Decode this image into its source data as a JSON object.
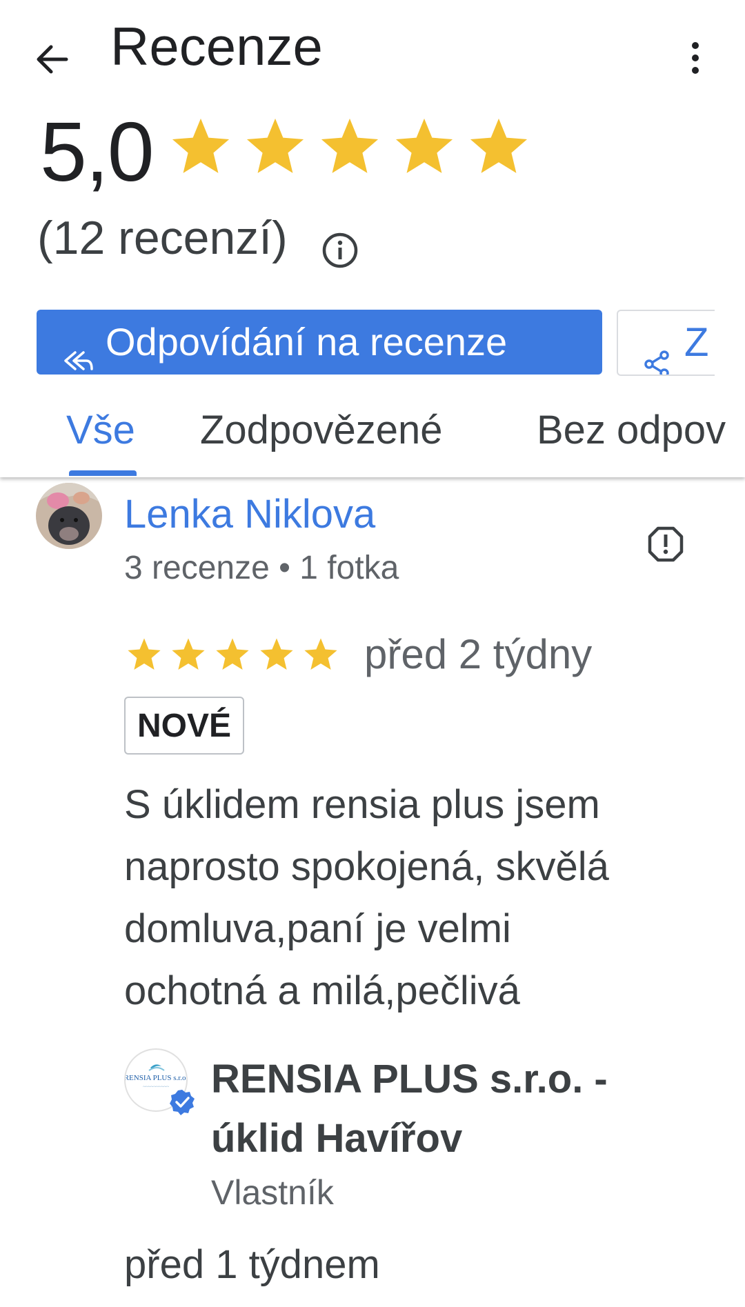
{
  "header": {
    "title": "Recenze",
    "rating": "5,0",
    "stars": 5,
    "review_count": "(12 recenzí)"
  },
  "actions": {
    "reply_label": "Odpovídání na recenze",
    "share_label_partial": "Z"
  },
  "tabs": [
    {
      "label": "Vše",
      "active": true
    },
    {
      "label": "Zodpovězené",
      "active": false
    },
    {
      "label": "Bez odpov",
      "active": false
    }
  ],
  "review": {
    "author": "Lenka Niklova",
    "meta": "3 recenze • 1 fotka",
    "stars": 5,
    "date": "před 2 týdny",
    "badge": "NOVÉ",
    "text_lines": [
      "S úklidem rensia plus jsem",
      "naprosto spokojená, skvělá",
      "domluva,paní je velmi",
      "ochotná a milá,pečlivá"
    ]
  },
  "owner_reply": {
    "logo_text": "RENSIA PLUS s.r.o.",
    "name_lines": [
      "RENSIA PLUS s.r.o. -",
      "úklid Havířov"
    ],
    "role": "Vlastník",
    "date": "před 1 týdnem"
  },
  "colors": {
    "accent": "#3d7ae0",
    "star": "#f4c030",
    "text": "#3c4043",
    "secondary_text": "#5f6368"
  },
  "icons": {
    "back": "arrow-left-icon",
    "more": "more-vert-icon",
    "info": "info-icon",
    "reply": "reply-all-icon",
    "share": "share-icon",
    "report": "report-icon",
    "verified": "verified-icon"
  }
}
